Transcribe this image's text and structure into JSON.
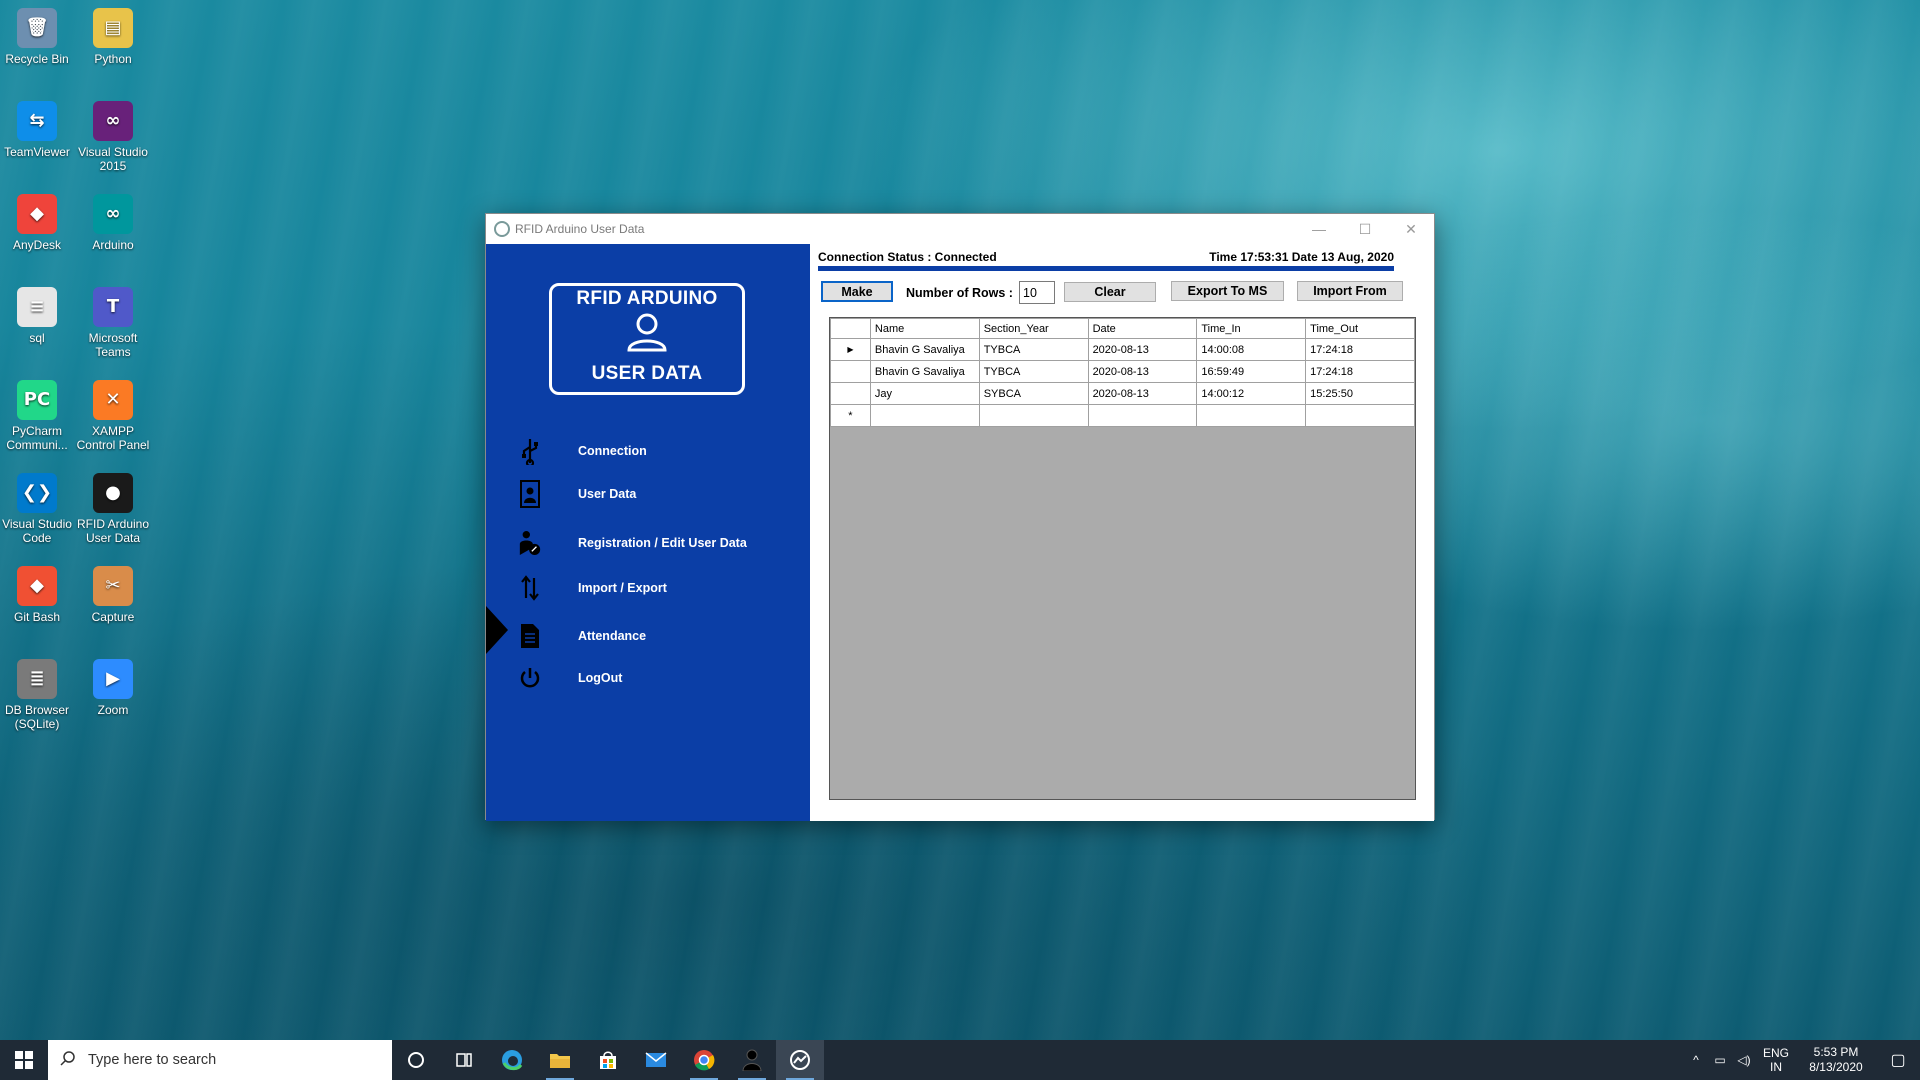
{
  "desktop": {
    "icons": [
      {
        "label": "Recycle Bin",
        "icon": "recycle-bin-icon",
        "color": "#6d8fb0"
      },
      {
        "label": "Python",
        "icon": "folder-icon",
        "color": "#e8c34a"
      },
      {
        "label": "TeamViewer",
        "icon": "teamviewer-icon",
        "color": "#0e8ee9"
      },
      {
        "label": "Visual Studio 2015",
        "icon": "visual-studio-icon",
        "color": "#68217a"
      },
      {
        "label": "AnyDesk",
        "icon": "anydesk-icon",
        "color": "#ef443b"
      },
      {
        "label": "Arduino",
        "icon": "arduino-icon",
        "color": "#00979d"
      },
      {
        "label": "sql",
        "icon": "file-icon",
        "color": "#e6e6e6"
      },
      {
        "label": "Microsoft Teams",
        "icon": "teams-icon",
        "color": "#5059c9"
      },
      {
        "label": "PyCharm Communi...",
        "icon": "pycharm-icon",
        "color": "#21d789"
      },
      {
        "label": "XAMPP Control Panel",
        "icon": "xampp-icon",
        "color": "#fb7a24"
      },
      {
        "label": "Visual Studio Code",
        "icon": "vscode-icon",
        "color": "#007acc"
      },
      {
        "label": "RFID Arduino User Data",
        "icon": "user-silhouette-icon",
        "color": "#1a1a1a"
      },
      {
        "label": "Git Bash",
        "icon": "git-icon",
        "color": "#f05033"
      },
      {
        "label": "Capture",
        "icon": "capture-icon",
        "color": "#d98c4a"
      },
      {
        "label": "DB Browser (SQLite)",
        "icon": "database-icon",
        "color": "#7a7a7a"
      },
      {
        "label": "Zoom",
        "icon": "zoom-icon",
        "color": "#2d8cff"
      }
    ]
  },
  "window": {
    "title": "RFID Arduino User Data",
    "minimize": "—",
    "maximize": "☐",
    "close": "✕"
  },
  "sidebar": {
    "logo_top": "RFID ARDUINO",
    "logo_bottom": "USER DATA",
    "items": [
      {
        "label": "Connection",
        "icon": "usb-icon"
      },
      {
        "label": "User Data",
        "icon": "user-file-icon"
      },
      {
        "label": "Registration / Edit User Data",
        "icon": "user-edit-icon"
      },
      {
        "label": "Import / Export",
        "icon": "import-export-arrows-icon"
      },
      {
        "label": "Attendance",
        "icon": "document-icon"
      },
      {
        "label": "LogOut",
        "icon": "power-icon"
      }
    ],
    "active_item": "Import / Export",
    "color": "#0b3ea6"
  },
  "content": {
    "connection_status": "Connection Status : Connected",
    "datetime": "Time 17:53:31  Date 13 Aug, 2020",
    "make_button": "Make",
    "rows_label": "Number of Rows :",
    "rows_value": "10",
    "clear_button": "Clear",
    "export_button": "Export To MS",
    "import_button": "Import From",
    "table": {
      "columns": [
        "Name",
        "Section_Year",
        "Date",
        "Time_In",
        "Time_Out"
      ],
      "rows": [
        [
          "Bhavin G Savaliya",
          "TYBCA",
          "2020-08-13",
          "14:00:08",
          "17:24:18"
        ],
        [
          "Bhavin G Savaliya",
          "TYBCA",
          "2020-08-13",
          "16:59:49",
          "17:24:18"
        ],
        [
          "Jay",
          "SYBCA",
          "2020-08-13",
          "14:00:12",
          "15:25:50"
        ]
      ],
      "current_row_marker": "▶",
      "new_row_marker": "*"
    }
  },
  "taskbar": {
    "search_placeholder": "Type here to search",
    "apps": [
      {
        "icon": "cortana-circle-icon"
      },
      {
        "icon": "task-view-icon"
      },
      {
        "icon": "edge-icon"
      },
      {
        "icon": "file-explorer-icon"
      },
      {
        "icon": "store-icon"
      },
      {
        "icon": "mail-icon"
      },
      {
        "icon": "chrome-icon"
      },
      {
        "icon": "user-silhouette-icon"
      },
      {
        "icon": "rfid-app-icon"
      }
    ],
    "lang_top": "ENG",
    "lang_bottom": "IN",
    "time": "5:53 PM",
    "date": "8/13/2020"
  }
}
